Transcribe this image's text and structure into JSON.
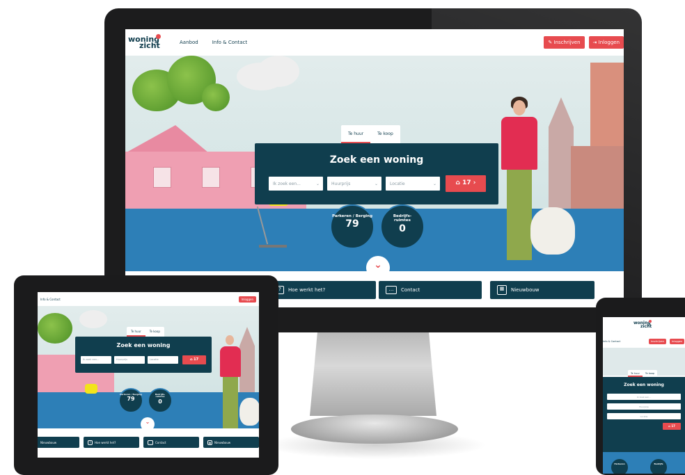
{
  "brand": {
    "logo_line1": "woning",
    "logo_line2": "zicht",
    "primary_color": "#103e4e",
    "accent_color": "#e74b4f",
    "ground_color": "#2d7fb7"
  },
  "desktop": {
    "nav": {
      "item1": "Aanbod",
      "item2": "Info & Contact"
    },
    "buttons": {
      "register": "Inschrijven",
      "login": "Inloggen"
    },
    "tabs": {
      "rent": "Te huur",
      "buy": "Te koop"
    },
    "search": {
      "title": "Zoek een woning",
      "select1": "Ik zoek een...",
      "select2": "Huurprijs",
      "select3": "Locatie",
      "go_label": "17",
      "go_icon": "house-icon"
    },
    "stats": [
      {
        "label": "Parkeren / Berging",
        "value": "79"
      },
      {
        "label": "Bedrijfs-ruimtes",
        "value": "0"
      }
    ],
    "features": [
      {
        "label": "Hoe werkt het?",
        "icon": "question-icon"
      },
      {
        "label": "Contact",
        "icon": "chat-icon"
      },
      {
        "label": "Nieuwbouw",
        "icon": "building-icon"
      }
    ]
  },
  "tablet": {
    "nav_item": "Info & Contact",
    "button": "Inloggen",
    "tabs": {
      "rent": "Te huur",
      "buy": "Te koop"
    },
    "search_title": "Zoek een woning",
    "select1": "Ik zoek een...",
    "select2": "Huurprijs",
    "select3": "Locatie",
    "go_label": "17",
    "stats": [
      {
        "label": "Parkeren / Berging",
        "value": "79"
      },
      {
        "label": "Bedrijfs-ruimtes",
        "value": "0"
      }
    ],
    "features": [
      {
        "label": "Nieuwbouw"
      },
      {
        "label": "Hoe werkt het?"
      },
      {
        "label": "Contact"
      },
      {
        "label": "Nieuwbouw"
      }
    ]
  },
  "phone": {
    "logo_line1": "woning",
    "logo_line2": "zicht",
    "nav_item": "Info & Contact",
    "buttons": {
      "register": "Inschrijven",
      "login": "Inloggen"
    },
    "tabs": {
      "rent": "Te huur",
      "buy": "Te koop"
    },
    "search_title": "Zoek een woning",
    "select1": "Ik zoek een...",
    "select2": "Huurprijs",
    "select3": "Locatie",
    "go_label": "17",
    "stats": [
      {
        "label": "Parkeren"
      },
      {
        "label": "Bedrijfs"
      }
    ]
  }
}
